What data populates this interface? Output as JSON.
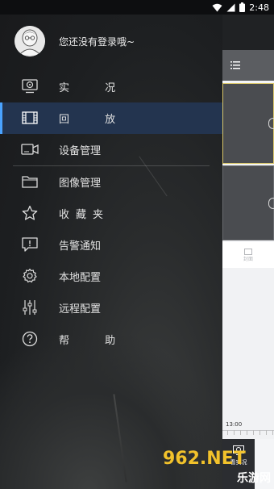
{
  "status_bar": {
    "time": "2:48"
  },
  "drawer": {
    "username": "您还没有登录哦~",
    "items": [
      {
        "label": "实 况",
        "icon": "monitor-icon",
        "active": false
      },
      {
        "label": "回 放",
        "icon": "film-icon",
        "active": true
      },
      {
        "label": "设备管理",
        "icon": "camera-icon",
        "active": false
      },
      {
        "label": "图像管理",
        "icon": "folder-icon",
        "active": false
      },
      {
        "label": "收藏夹",
        "icon": "star-icon",
        "active": false
      },
      {
        "label": "告警通知",
        "icon": "alert-message-icon",
        "active": false
      },
      {
        "label": "本地配置",
        "icon": "gear-icon",
        "active": false
      },
      {
        "label": "远程配置",
        "icon": "sliders-icon",
        "active": false
      },
      {
        "label": "帮 助",
        "icon": "help-icon",
        "active": false
      }
    ]
  },
  "background_app": {
    "strip_label": "封面",
    "timeline_time": "13:00",
    "live_button_label": "看实况"
  },
  "watermark": {
    "top": "962.NET",
    "bottom": "乐游网"
  },
  "colors": {
    "active_bg": "#23344f",
    "active_indicator": "#4aa3ff"
  }
}
